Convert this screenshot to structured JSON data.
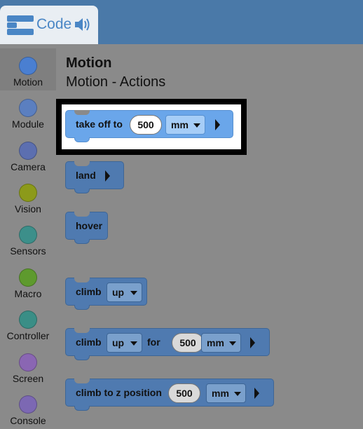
{
  "header": {
    "tab_title": "Code",
    "logo_icon": "blocks-logo-icon",
    "speaker_icon": "speaker-icon"
  },
  "sidebar": {
    "items": [
      {
        "label": "Motion",
        "color": "#4a7fd1",
        "selected": true
      },
      {
        "label": "Module",
        "color": "#5b7fc0"
      },
      {
        "label": "Camera",
        "color": "#5c6fb0"
      },
      {
        "label": "Vision",
        "color": "#8c9a1a"
      },
      {
        "label": "Sensors",
        "color": "#3c8f8a"
      },
      {
        "label": "Macro",
        "color": "#5e9a2e"
      },
      {
        "label": "Controller",
        "color": "#3a8e86"
      },
      {
        "label": "Screen",
        "color": "#8a66b3"
      },
      {
        "label": "Console",
        "color": "#7c68b3"
      }
    ]
  },
  "flyout": {
    "heading": "Motion",
    "subheading": "Motion - Actions",
    "blocks": {
      "take_off": {
        "label": "take off to",
        "value": "500",
        "unit": "mm"
      },
      "land": {
        "label": "land"
      },
      "hover": {
        "label": "hover"
      },
      "climb": {
        "label": "climb",
        "direction": "up"
      },
      "climb_for": {
        "label": "climb",
        "direction": "up",
        "for": "for",
        "value": "500",
        "unit": "mm"
      },
      "climb_z": {
        "label": "climb to z position",
        "value": "500",
        "unit": "mm"
      }
    }
  }
}
